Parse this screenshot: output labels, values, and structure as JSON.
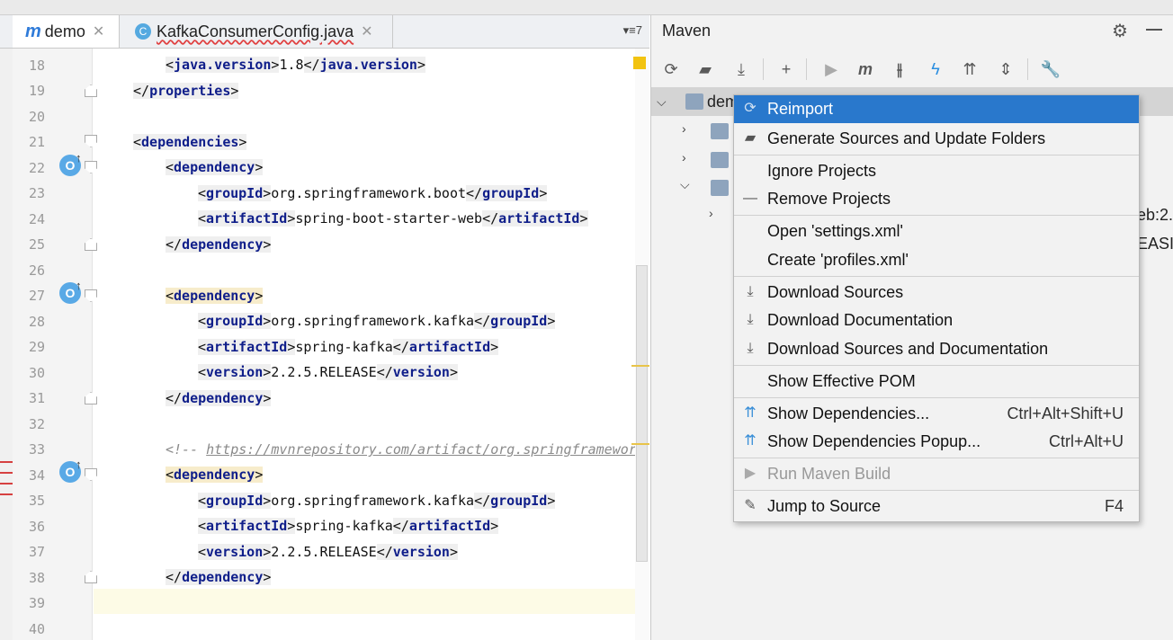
{
  "colors": {
    "accent": "#2978cc",
    "tag": "#0f1e8a",
    "warning": "#f2c310"
  },
  "editor": {
    "tabs": [
      {
        "label": "demo",
        "icon": "maven-m-icon"
      },
      {
        "label": "KafkaConsumerConfig.java",
        "icon": "java-class-icon"
      }
    ],
    "tab_overflow": "7",
    "lines": [
      {
        "n": "18"
      },
      {
        "n": "19"
      },
      {
        "n": "20"
      },
      {
        "n": "21"
      },
      {
        "n": "22"
      },
      {
        "n": "23"
      },
      {
        "n": "24"
      },
      {
        "n": "25"
      },
      {
        "n": "26"
      },
      {
        "n": "27"
      },
      {
        "n": "28"
      },
      {
        "n": "29"
      },
      {
        "n": "30"
      },
      {
        "n": "31"
      },
      {
        "n": "32"
      },
      {
        "n": "33"
      },
      {
        "n": "34"
      },
      {
        "n": "35"
      },
      {
        "n": "36"
      },
      {
        "n": "37"
      },
      {
        "n": "38"
      },
      {
        "n": "39"
      },
      {
        "n": "40"
      }
    ],
    "code": {
      "l18_tag": "java.version",
      "l18_val": "1.8",
      "l19_tag": "properties",
      "l21_tag": "dependencies",
      "l22_tag": "dependency",
      "l23_tag": "groupId",
      "l23_val": "org.springframework.boot",
      "l24_tag": "artifactId",
      "l24_val": "spring-boot-starter-web",
      "l25_tag": "dependency",
      "l27_tag": "dependency",
      "l28_tag": "groupId",
      "l28_val": "org.springframework.kafka",
      "l29_tag": "artifactId",
      "l29_val": "spring-kafka",
      "l30_tag": "version",
      "l30_val": "2.2.5.RELEASE",
      "l31_tag": "dependency",
      "l33_comment_open": "<!-- ",
      "l33_url": "https://mvnrepository.com/artifact/org.springframework.",
      "l34_tag": "dependency",
      "l35_tag": "groupId",
      "l35_val": "org.springframework.kafka",
      "l36_tag": "artifactId",
      "l36_val": "spring-kafka",
      "l37_tag": "version",
      "l37_val": "2.2.5.RELEASE",
      "l38_tag": "dependency"
    },
    "gutter_override_glyph": "O"
  },
  "maven": {
    "title": "Maven",
    "tree": {
      "root_label": "dem",
      "side_text_1": "eb:2.",
      "side_text_2": "EASI"
    },
    "context_menu": [
      {
        "label": "Reimport",
        "shortcut": "",
        "icon": "reimport-icon",
        "selected": true
      },
      {
        "label": "Generate Sources and Update Folders",
        "shortcut": "",
        "icon": "generate-sources-icon"
      },
      {
        "label": "Ignore Projects",
        "shortcut": "",
        "icon": ""
      },
      {
        "label": "Remove Projects",
        "shortcut": "",
        "icon": "remove-icon"
      },
      {
        "label": "Open 'settings.xml'",
        "shortcut": "",
        "icon": ""
      },
      {
        "label": "Create 'profiles.xml'",
        "shortcut": "",
        "icon": ""
      },
      {
        "label": "Download Sources",
        "shortcut": "",
        "icon": "download-icon"
      },
      {
        "label": "Download Documentation",
        "shortcut": "",
        "icon": "download-icon"
      },
      {
        "label": "Download Sources and Documentation",
        "shortcut": "",
        "icon": "download-icon"
      },
      {
        "label": "Show Effective POM",
        "shortcut": "",
        "icon": ""
      },
      {
        "label": "Show Dependencies...",
        "shortcut": "Ctrl+Alt+Shift+U",
        "icon": "dependencies-icon"
      },
      {
        "label": "Show Dependencies Popup...",
        "shortcut": "Ctrl+Alt+U",
        "icon": "dependencies-icon"
      },
      {
        "label": "Run Maven Build",
        "shortcut": "",
        "icon": "run-icon",
        "disabled": true
      },
      {
        "label": "Jump to Source",
        "shortcut": "F4",
        "icon": "edit-icon"
      }
    ]
  }
}
